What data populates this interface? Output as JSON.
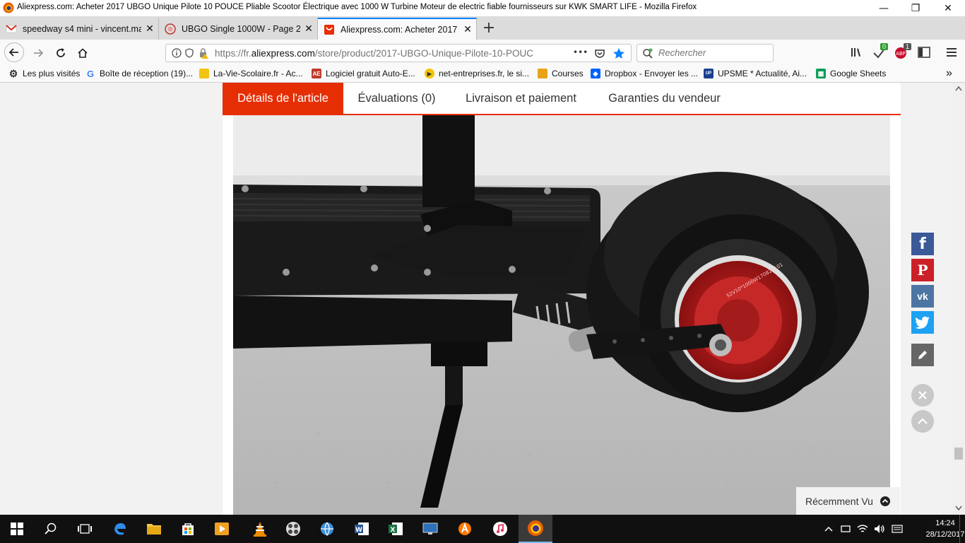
{
  "window": {
    "title": "Aliexpress.com: Acheter 2017 UBGO Unique Pilote 10 POUCE Pliable Scootor Électrique avec 1000 W Turbine Moteur de electric fiable fournisseurs sur KWK SMART LIFE - Mozilla Firefox",
    "minimize": "—",
    "maximize": "❐",
    "close": "✕"
  },
  "tabs": [
    {
      "label": "speedway s4 mini - vincent.ma",
      "close": "✕"
    },
    {
      "label": "UBGO Single 1000W - Page 2 - A",
      "close": "✕"
    },
    {
      "label": "Aliexpress.com: Acheter 2017 U",
      "close": "✕"
    }
  ],
  "new_tab": "+",
  "nav": {
    "url_prefix": "https://fr.",
    "url_domain": "aliexpress.com",
    "url_rest": "/store/product/2017-UBGO-Unique-Pilote-10-POUC",
    "more": "•••",
    "search_placeholder": "Rechercher"
  },
  "badges": {
    "green": "0",
    "adblock": "1"
  },
  "bookmarks": [
    "Les plus visités",
    "Boîte de réception (19)...",
    "La-Vie-Scolaire.fr - Ac...",
    "Logiciel gratuit Auto-E...",
    "net-entreprises.fr, le si...",
    "Courses",
    "Dropbox - Envoyer les ...",
    "UPSME * Actualité, Ai...",
    "Google Sheets"
  ],
  "bookmarks_more": "»",
  "product_tabs": [
    "Détails de l'article",
    "Évaluations (0)",
    "Livraison et paiement",
    "Garanties du vendeur"
  ],
  "motor_label": "52V10*1000W170825101",
  "social": {
    "facebook": "f",
    "pinterest": "P",
    "vk": "vk"
  },
  "recent": "Récemment Vu",
  "clock": {
    "time": "14:24",
    "date": "28/12/2017"
  },
  "colors": {
    "accent": "#e62e04",
    "facebook": "#3b5998",
    "pinterest": "#cb2027",
    "vk": "#4c75a3",
    "twitter": "#1da1f2",
    "taskbar": "#101010"
  }
}
